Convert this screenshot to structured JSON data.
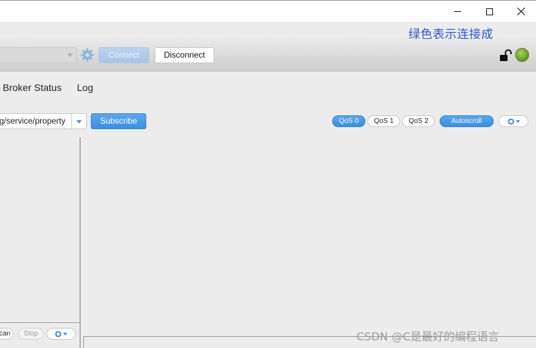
{
  "window": {
    "minimize_label": "",
    "maximize_label": "",
    "close_label": ""
  },
  "annotation": "绿色表示连接成",
  "toolbar": {
    "profile_value": "",
    "connect_label": "Connect",
    "disconnect_label": "Disconnect",
    "connection_status_color": "#5c9a1d"
  },
  "tabs": [
    {
      "label": "Broker Status"
    },
    {
      "label": "Log"
    }
  ],
  "subscribe": {
    "topic_value": "g/service/property",
    "subscribe_label": "Subscribe",
    "qos": [
      "QoS 0",
      "QoS 1",
      "QoS 2"
    ],
    "selected_qos": "QoS 0",
    "autoscroll_label": "Autoscroll"
  },
  "bottom_left": {
    "scan_label": "can",
    "stop_label": "Stop"
  },
  "watermark": "CSDN @C是最好的编程语言",
  "colors": {
    "accent": "#3b8de0",
    "annotation": "#2f56c5"
  },
  "icons": [
    "gear-icon",
    "lock-open-icon",
    "chevron-down-icon",
    "close-icon"
  ]
}
